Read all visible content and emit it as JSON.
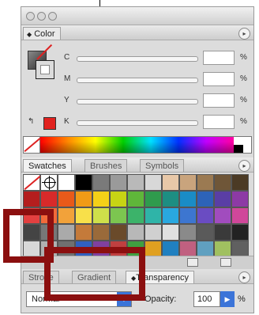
{
  "color_panel": {
    "tab_label": "Color",
    "channels": [
      {
        "label": "C",
        "value": "",
        "unit": "%"
      },
      {
        "label": "M",
        "value": "",
        "unit": "%"
      },
      {
        "label": "Y",
        "value": "",
        "unit": "%"
      },
      {
        "label": "K",
        "value": "",
        "unit": "%"
      }
    ],
    "out_of_gamut_color": "#e1221f"
  },
  "swatches_panel": {
    "tabs": [
      "Swatches",
      "Brushes",
      "Symbols"
    ]
  },
  "bottom_panel": {
    "tabs": [
      "Stroke",
      "Gradient",
      "Transparency"
    ],
    "blend_mode": "Normal",
    "opacity_label": "Opacity:",
    "opacity_value": "100",
    "opacity_unit": "%"
  },
  "annotation_color": "#8b0f0f"
}
